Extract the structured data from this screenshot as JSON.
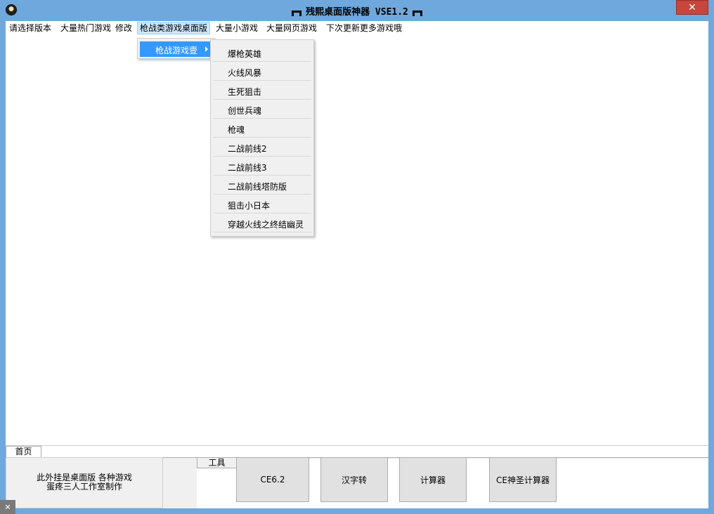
{
  "window": {
    "title": "残熙桌面版神器 VSE1.2",
    "close_label": "✕"
  },
  "menubar": {
    "items": [
      {
        "label": "请选择版本"
      },
      {
        "label": "大量热门游戏"
      },
      {
        "label": "修改"
      },
      {
        "label": "枪战类游戏桌面版"
      },
      {
        "label": "大量小游戏"
      },
      {
        "label": "大量网页游戏"
      },
      {
        "label": "下次更新更多游戏哦"
      }
    ]
  },
  "submenu": {
    "label": "枪战游戏壹"
  },
  "submenu_items": [
    {
      "label": "爆枪英雄"
    },
    {
      "label": "火线风暴"
    },
    {
      "label": "生死狙击"
    },
    {
      "label": "创世兵魂"
    },
    {
      "label": "枪魂"
    },
    {
      "label": "二战前线2"
    },
    {
      "label": "二战前线3"
    },
    {
      "label": "二战前线塔防版"
    },
    {
      "label": "狙击小日本"
    },
    {
      "label": "穿越火线之终结幽灵"
    }
  ],
  "tabs": {
    "home": "首页"
  },
  "info": {
    "line1": "此外挂是桌面版 各种游戏",
    "line2": "蛋疼三人工作室制作"
  },
  "tools": {
    "group_label": "工具",
    "buttons": [
      {
        "label": "CE6.2"
      },
      {
        "label": "汉字转"
      },
      {
        "label": "计算器"
      },
      {
        "label": "CE神圣计算器"
      }
    ]
  },
  "corner": {
    "label": "✕"
  }
}
